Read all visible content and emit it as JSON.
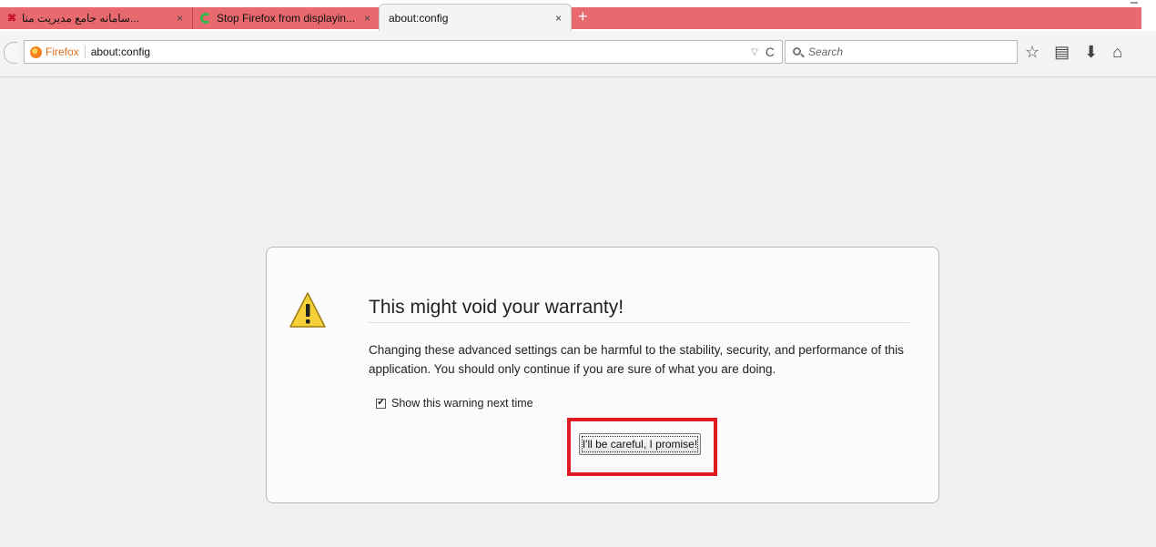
{
  "tabs": [
    {
      "label": "...سامانه جامع مدیریت منا",
      "close": "×",
      "icon": "site-favicon",
      "active": false
    },
    {
      "label": "Stop Firefox from displayin...",
      "close": "×",
      "icon": "loading-spinner",
      "active": false
    },
    {
      "label": "about:config",
      "close": "×",
      "icon": "",
      "active": true
    }
  ],
  "newtab_label": "+",
  "navbar": {
    "identity": "Firefox",
    "url": "about:config",
    "dropdown_glyph": "▽",
    "reload_glyph": "C",
    "search_placeholder": "Search",
    "icons": [
      "bookmark-star-icon",
      "reading-list-icon",
      "download-icon",
      "home-icon"
    ]
  },
  "dialog": {
    "title": "This might void your warranty!",
    "body": "Changing these advanced settings can be harmful to the stability, security, and performance of this application. You should only continue if you are sure of what you are doing.",
    "checkbox_label": "Show this warning next time",
    "checkbox_checked": true,
    "button_label": "I'll be careful, I promise!"
  },
  "colors": {
    "tabstrip_red": "#e86a6e",
    "identity_orange": "#e0701b",
    "highlight_red": "#e11b23",
    "warning_yellow": "#f6d13a"
  }
}
